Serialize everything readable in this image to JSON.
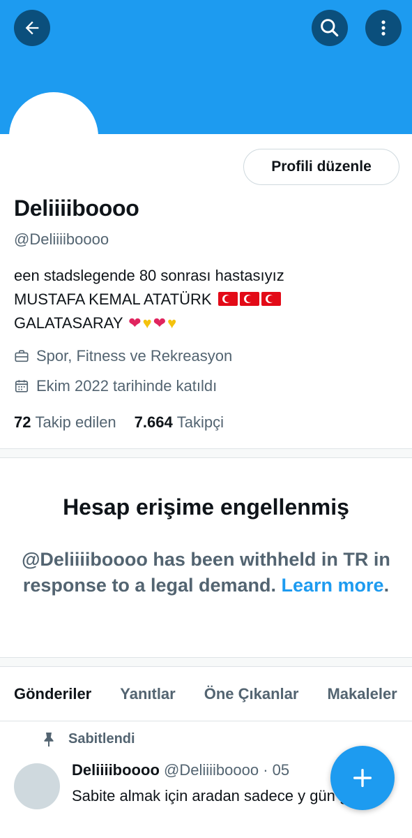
{
  "header": {
    "back_icon": "arrow-left-icon",
    "search_icon": "search-icon",
    "more_icon": "more-vertical-icon",
    "banner_color": "#1d9bf0"
  },
  "profile": {
    "edit_label": "Profili düzenle",
    "name": "Deliiiiboooo",
    "handle": "@Deliiiiboooo",
    "bio_line1": "een stadslegende 80 sonrası hastasıyız",
    "bio_line2": "MUSTAFA KEMAL ATATÜRK",
    "bio_line3": "GALATASARAY",
    "category": "Spor, Fitness ve Rekreasyon",
    "joined": "Ekim 2022 tarihinde katıldı",
    "following_count": "72",
    "following_label": "Takip edilen",
    "followers_count": "7.664",
    "followers_label": "Takipçi"
  },
  "withheld": {
    "title": "Hesap erişime engellenmiş",
    "text": "@Deliiiiboooo has been withheld in TR in response to a legal demand.",
    "link": "Learn more",
    "end": "."
  },
  "tabs": [
    "Gönderiler",
    "Yanıtlar",
    "Öne Çıkanlar",
    "Makaleler"
  ],
  "post": {
    "pinned_label": "Sabitlendi",
    "author": "Deliiiiboooo",
    "handle_date": "@Deliiiiboooo · 05",
    "text": "Sabite almak için aradan sadece y gün geçti"
  },
  "fab": {
    "icon": "plus-icon"
  },
  "colors": {
    "accent": "#1d9bf0",
    "muted": "#536471",
    "text": "#0f1419"
  }
}
